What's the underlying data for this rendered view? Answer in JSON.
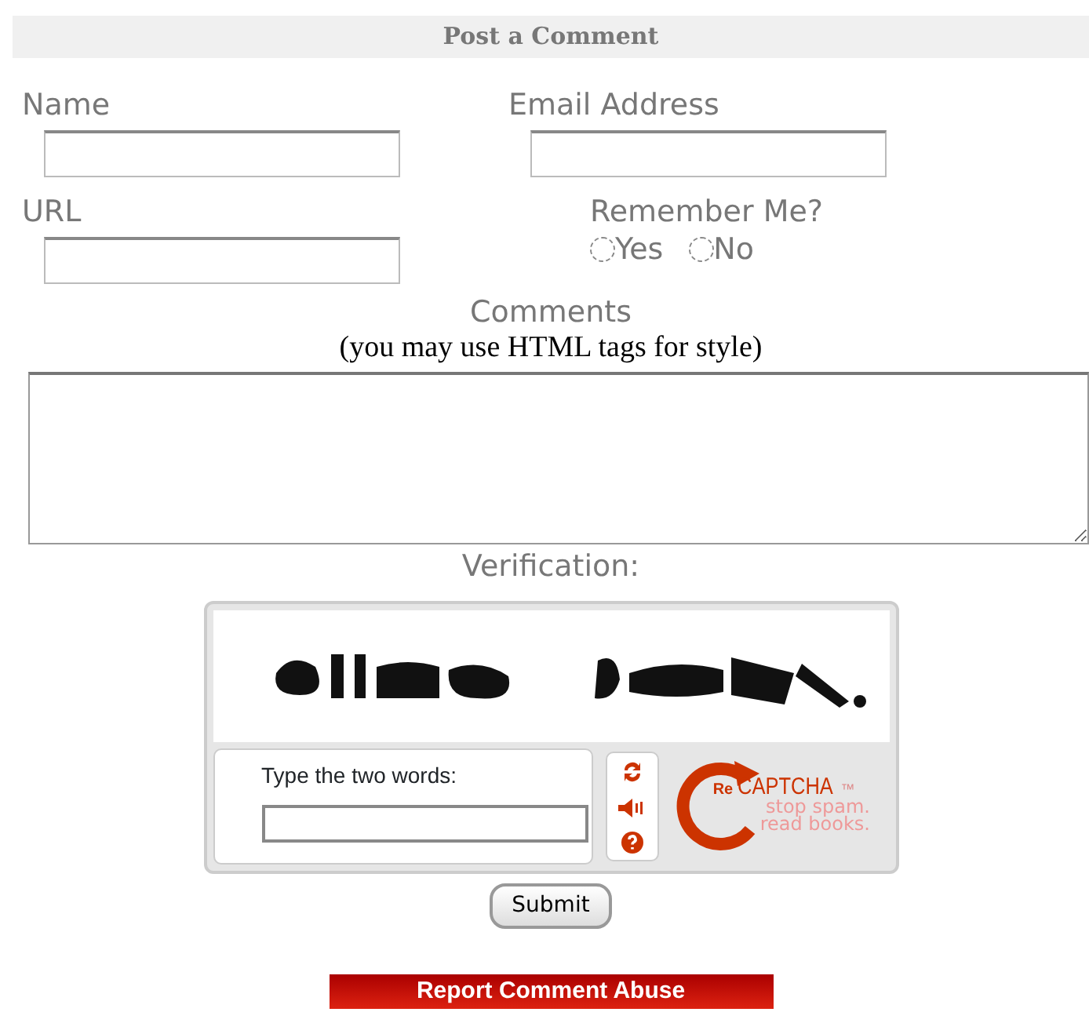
{
  "heading": "Post a Comment",
  "fields": [
    {
      "label": "Name"
    },
    {
      "label": "Email Address"
    },
    {
      "label": "URL"
    }
  ],
  "remember": {
    "label": "Remember Me?",
    "options": [
      {
        "label": "Yes",
        "selected": false
      },
      {
        "label": "No",
        "selected": false
      }
    ]
  },
  "comments": {
    "label": "Comments",
    "hint": "(you may use HTML tags for style)"
  },
  "verification": {
    "label": "Verification:",
    "captcha": {
      "prompt": "Type the two words:",
      "logo_re": "Re",
      "logo_name": "CAPTCHA",
      "logo_tm": "™",
      "tagline": "stop spam.\nread books."
    }
  },
  "submit": "Submit",
  "report": "Report Comment Abuse"
}
